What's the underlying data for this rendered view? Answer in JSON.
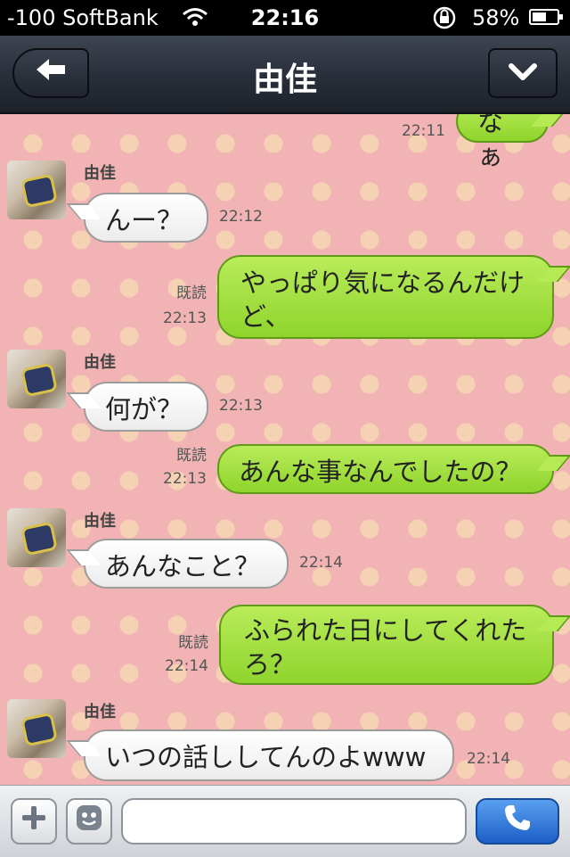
{
  "status_bar": {
    "carrier": "-100 SoftBank",
    "time": "22:16",
    "battery_percent": "58%",
    "battery_level": 0.58,
    "icons": [
      "wifi-icon",
      "orientation-lock-icon",
      "battery-icon"
    ]
  },
  "nav": {
    "title": "由佳",
    "back_icon": "back-arrow-icon",
    "menu_icon": "chevron-down-icon"
  },
  "messages": [
    {
      "side": "out",
      "text": "なぁ",
      "time": "22:11"
    },
    {
      "side": "in",
      "sender": "由佳",
      "text": "んー？",
      "time": "22:12"
    },
    {
      "side": "out",
      "text": "やっぱり気になるんだけど、",
      "read": "既読",
      "time": "22:13"
    },
    {
      "side": "in",
      "sender": "由佳",
      "text": "何が？",
      "time": "22:13"
    },
    {
      "side": "out",
      "text": "あんな事なんでしたの？",
      "read": "既読",
      "time": "22:13"
    },
    {
      "side": "in",
      "sender": "由佳",
      "text": "あんなこと？",
      "time": "22:14"
    },
    {
      "side": "out",
      "text": "ふられた日にしてくれたろ？",
      "read": "既読",
      "time": "22:14"
    },
    {
      "side": "in",
      "sender": "由佳",
      "text": "いつの話ししてんのよwww",
      "time": "22:14"
    }
  ],
  "input_bar": {
    "placeholder": "",
    "icons": [
      "plus-icon",
      "emoji-icon",
      "phone-icon"
    ]
  },
  "colors": {
    "background": "#f1b3b3",
    "dots": "#f6d2b4",
    "outgoing_bubble": "#a6e245",
    "incoming_bubble": "#ffffff",
    "navbar": "#2a303b",
    "call_button": "#2f7be0"
  }
}
